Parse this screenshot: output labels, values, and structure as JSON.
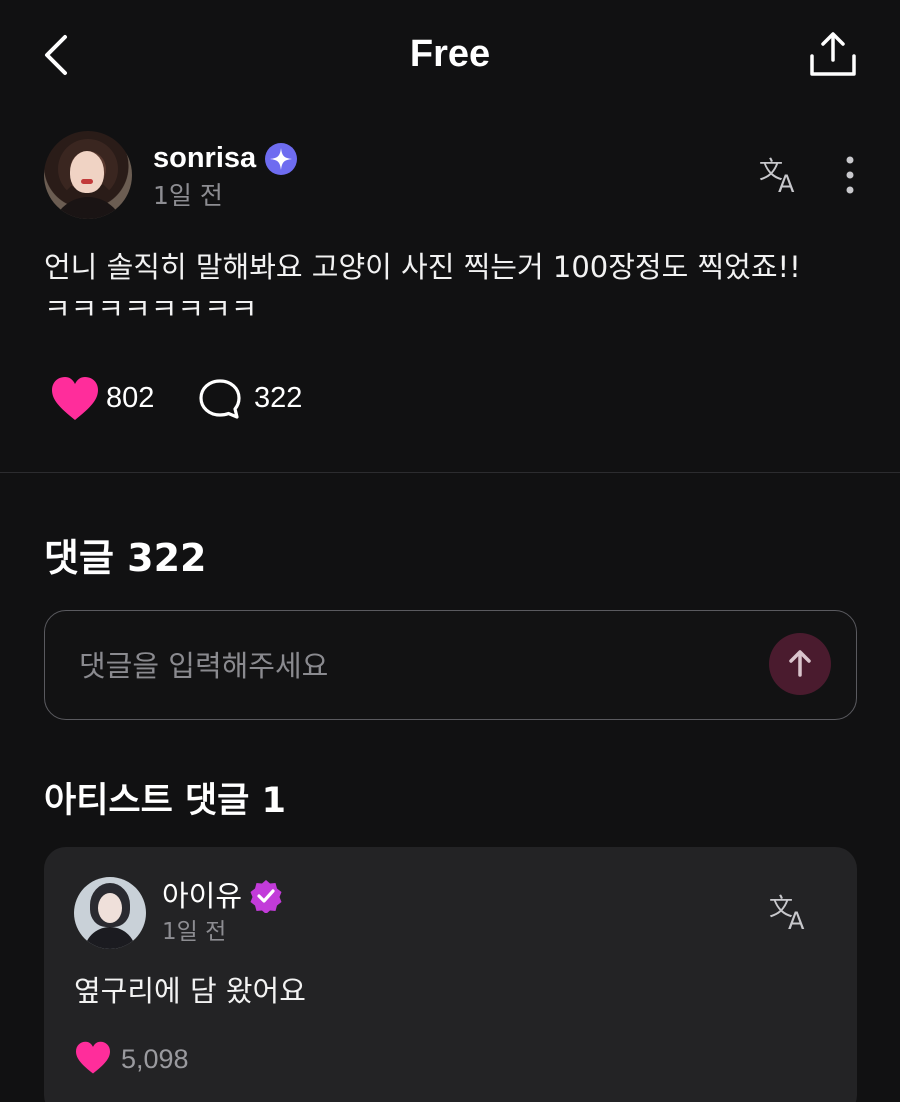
{
  "header": {
    "title": "Free"
  },
  "post": {
    "author": {
      "username": "sonrisa",
      "timestamp": "1일 전"
    },
    "text_line1": "언니 솔직히 말해봐요 고양이 사진 찍는거 100장정도 찍었죠!!",
    "text_line2": "ㅋㅋㅋㅋㅋㅋㅋㅋ",
    "like_count": "802",
    "comment_count": "322"
  },
  "comments": {
    "heading": "댓글 322",
    "input_placeholder": "댓글을 입력해주세요"
  },
  "artist_comments": {
    "heading": "아티스트 댓글 1",
    "items": [
      {
        "name": "아이유",
        "timestamp": "1일 전",
        "text": "옆구리에 담 왔어요",
        "like_count": "5,098"
      }
    ]
  },
  "colors": {
    "background": "#111112",
    "accent_pink": "#ff2d9b",
    "fan_badge": "#6e6cf0",
    "artist_badge": "#c23bd9",
    "send_button": "#4a1b2e"
  },
  "icons": {
    "back": "chevron-left-icon",
    "share": "share-upload-icon",
    "translate": "translate-icon",
    "more": "more-vertical-icon",
    "like": "heart-icon",
    "comment": "speech-bubble-icon",
    "send": "arrow-up-icon"
  }
}
